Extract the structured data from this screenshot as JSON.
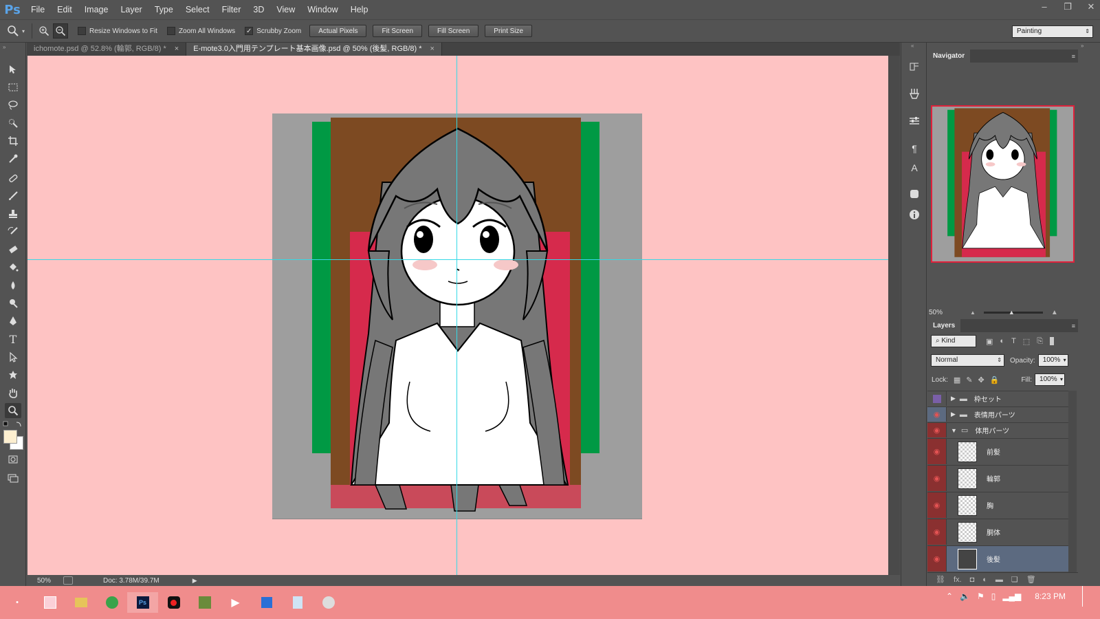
{
  "app": {
    "logo": "Ps"
  },
  "menu": [
    "File",
    "Edit",
    "Image",
    "Layer",
    "Type",
    "Select",
    "Filter",
    "3D",
    "View",
    "Window",
    "Help"
  ],
  "window_controls": [
    "minimize-icon",
    "restore-icon",
    "close-icon"
  ],
  "options_bar": {
    "resize_windows": {
      "label": "Resize Windows to Fit",
      "checked": false
    },
    "zoom_all": {
      "label": "Zoom All Windows",
      "checked": false
    },
    "scrubby_zoom": {
      "label": "Scrubby Zoom",
      "checked": true
    },
    "check_mark": "✓",
    "buttons": [
      "Actual Pixels",
      "Fit Screen",
      "Fill Screen",
      "Print Size"
    ],
    "workspace": "Painting"
  },
  "tabs": [
    {
      "label": "ichomote.psd @ 52.8% (輪郭, RGB/8) *",
      "active": false,
      "close": "×"
    },
    {
      "label": "E-mote3.0入門用テンプレート基本画像.psd @ 50% (後髪, RGB/8) *",
      "active": true,
      "close": "×"
    }
  ],
  "status": {
    "zoom": "50%",
    "doc": "Doc: 3.78M/39.7M"
  },
  "navigator": {
    "title": "Navigator",
    "zoom": "50%"
  },
  "layers": {
    "title": "Layers",
    "filter_kind": "Kind",
    "blend_mode": "Normal",
    "opacity_label": "Opacity:",
    "opacity": "100%",
    "lock_label": "Lock:",
    "fill_label": "Fill:",
    "fill": "100%",
    "groups": [
      {
        "name": "枠セット",
        "expanded": false,
        "visible": false
      },
      {
        "name": "表情用パーツ",
        "expanded": false,
        "visible": true
      },
      {
        "name": "体用パーツ",
        "expanded": true,
        "visible": true
      }
    ],
    "items": [
      {
        "name": "前髪",
        "visible": true,
        "selected": false
      },
      {
        "name": "輪郭",
        "visible": true,
        "selected": false
      },
      {
        "name": "胸",
        "visible": true,
        "selected": false
      },
      {
        "name": "胴体",
        "visible": true,
        "selected": false
      },
      {
        "name": "後髪",
        "visible": true,
        "selected": true
      }
    ],
    "footer_fx": "fx."
  },
  "taskbar": {
    "time": "8:23 PM"
  },
  "colors": {
    "canvas_bg": "#fec3c3",
    "guide": "#35d9e6",
    "taskbar": "#f08c8c",
    "selected_layer": "#5c6a80"
  }
}
